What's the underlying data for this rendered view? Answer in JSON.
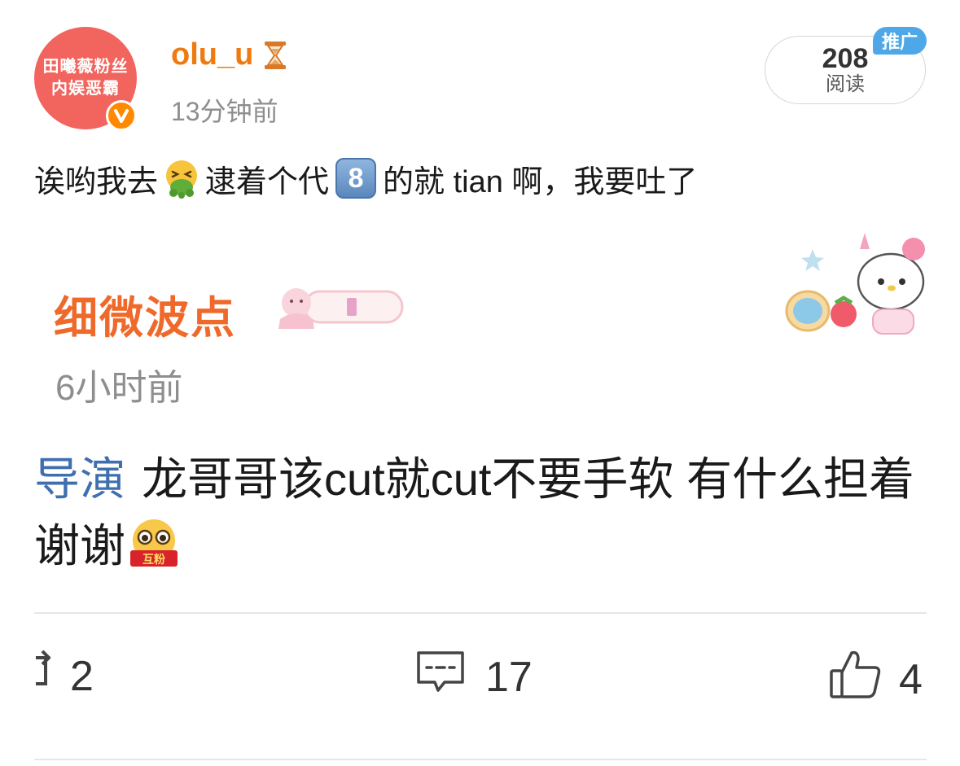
{
  "header": {
    "avatar_line1": "田曦薇粉丝",
    "avatar_line2": "内娱恶霸",
    "username": "olu_u",
    "post_time": "13分钟前",
    "reads_count": "208",
    "reads_label": "阅读",
    "promo_badge": "推广"
  },
  "post": {
    "text_part1": "诶哟我去",
    "text_part2": "逮着个代",
    "keycap": "8",
    "text_part3": "的就 tian 啊，我要吐了",
    "emoji": "vomit-face-icon"
  },
  "quote": {
    "author": "细微波点",
    "time": "6小时前",
    "mention": "导演",
    "body": "龙哥哥该cut就cut不要手软 有什么担着谢谢",
    "emoji": "fan-face-icon",
    "emoji_label": "互粉"
  },
  "actions": {
    "repost_count": "2",
    "comment_count": "17",
    "like_count": "4"
  },
  "colors": {
    "username": "#f07a0e",
    "avatar_bg": "#f2655f",
    "mention": "#3f6fae",
    "quote_author": "#ef6a2a",
    "promo_badge": "#4ea8e8"
  }
}
